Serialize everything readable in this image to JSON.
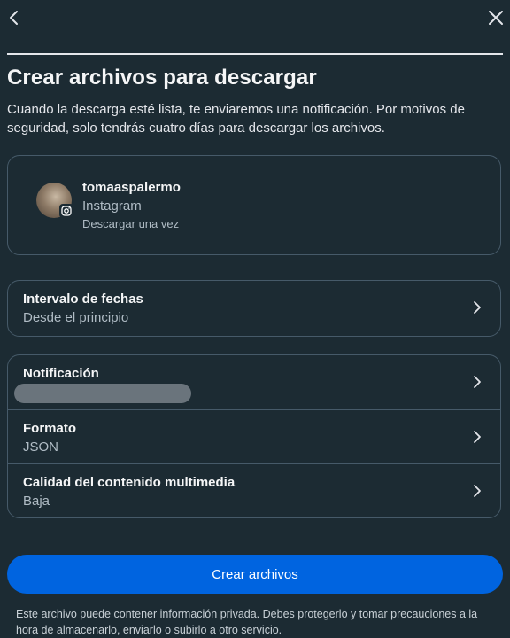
{
  "header": {
    "back_icon": "chevron-left-icon",
    "close_icon": "close-icon"
  },
  "title": "Crear archivos para descargar",
  "description": "Cuando la descarga esté lista, te enviaremos una notificación. Por motivos de seguridad, solo tendrás cuatro días para descargar los archivos.",
  "account": {
    "username": "tomaaspalermo",
    "platform": "Instagram",
    "mode": "Descargar una vez",
    "badge_icon": "instagram-icon"
  },
  "date_range": {
    "label": "Intervalo de fechas",
    "value": "Desde el principio"
  },
  "settings": {
    "notification": {
      "label": "Notificación",
      "value": ""
    },
    "format": {
      "label": "Formato",
      "value": "JSON"
    },
    "media_quality": {
      "label": "Calidad del contenido multimedia",
      "value": "Baja"
    }
  },
  "primary_button": "Crear archivos",
  "footnote": "Este archivo puede contener información privada. Debes protegerlo y tomar precauciones a la hora de almacenarlo, enviarlo o subirlo a otro servicio.",
  "colors": {
    "background": "#1c2b33",
    "border": "#465a69",
    "accent": "#0064e0",
    "muted_text": "#b0bcc5"
  }
}
